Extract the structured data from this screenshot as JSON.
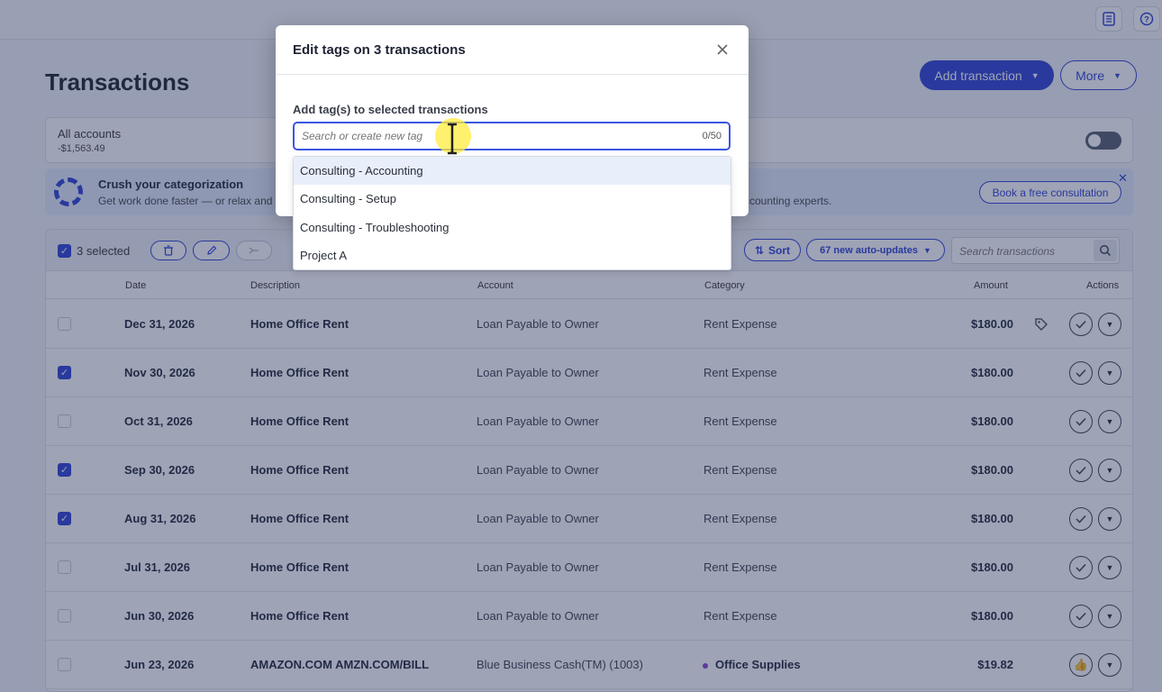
{
  "page": {
    "title": "Transactions",
    "add_transaction_label": "Add transaction",
    "more_label": "More"
  },
  "accounts": {
    "name": "All accounts",
    "balance": "-$1,563.49"
  },
  "promo": {
    "title": "Crush your categorization",
    "text": "Get work done faster — or relax and h",
    "text_right": "ccounting experts.",
    "cta": "Book a free consultation"
  },
  "toolbar": {
    "selected_label": "3 selected",
    "sort_label": "Sort",
    "auto_updates_label": "67 new auto-updates",
    "search_placeholder": "Search transactions"
  },
  "table": {
    "headers": {
      "date": "Date",
      "description": "Description",
      "account": "Account",
      "category": "Category",
      "amount": "Amount",
      "actions": "Actions"
    },
    "rows": [
      {
        "checked": false,
        "date": "Dec 31, 2026",
        "description": "Home Office Rent",
        "account": "Loan Payable to Owner",
        "category": "Rent Expense",
        "amount": "$180.00",
        "tagged": true
      },
      {
        "checked": true,
        "date": "Nov 30, 2026",
        "description": "Home Office Rent",
        "account": "Loan Payable to Owner",
        "category": "Rent Expense",
        "amount": "$180.00",
        "tagged": false
      },
      {
        "checked": false,
        "date": "Oct 31, 2026",
        "description": "Home Office Rent",
        "account": "Loan Payable to Owner",
        "category": "Rent Expense",
        "amount": "$180.00",
        "tagged": false
      },
      {
        "checked": true,
        "date": "Sep 30, 2026",
        "description": "Home Office Rent",
        "account": "Loan Payable to Owner",
        "category": "Rent Expense",
        "amount": "$180.00",
        "tagged": false
      },
      {
        "checked": true,
        "date": "Aug 31, 2026",
        "description": "Home Office Rent",
        "account": "Loan Payable to Owner",
        "category": "Rent Expense",
        "amount": "$180.00",
        "tagged": false
      },
      {
        "checked": false,
        "date": "Jul 31, 2026",
        "description": "Home Office Rent",
        "account": "Loan Payable to Owner",
        "category": "Rent Expense",
        "amount": "$180.00",
        "tagged": false
      },
      {
        "checked": false,
        "date": "Jun 30, 2026",
        "description": "Home Office Rent",
        "account": "Loan Payable to Owner",
        "category": "Rent Expense",
        "amount": "$180.00",
        "tagged": false
      },
      {
        "checked": false,
        "date": "Jun 23, 2026",
        "description": "AMAZON.COM AMZN.COM/BILL",
        "account": "Blue Business Cash(TM) (1003)",
        "category": "Office Supplies",
        "amount": "$19.82",
        "tagged": false,
        "category_dot": true,
        "thumbs": true
      }
    ]
  },
  "modal": {
    "title": "Edit tags on 3 transactions",
    "field_label": "Add tag(s) to selected transactions",
    "input_placeholder": "Search or create new tag",
    "counter": "0/50",
    "options": [
      "Consulting - Accounting",
      "Consulting - Setup",
      "Consulting - Troubleshooting",
      "Project A"
    ]
  },
  "colors": {
    "accent": "#2a3fd4",
    "category_dot": "#8a3fd1"
  }
}
